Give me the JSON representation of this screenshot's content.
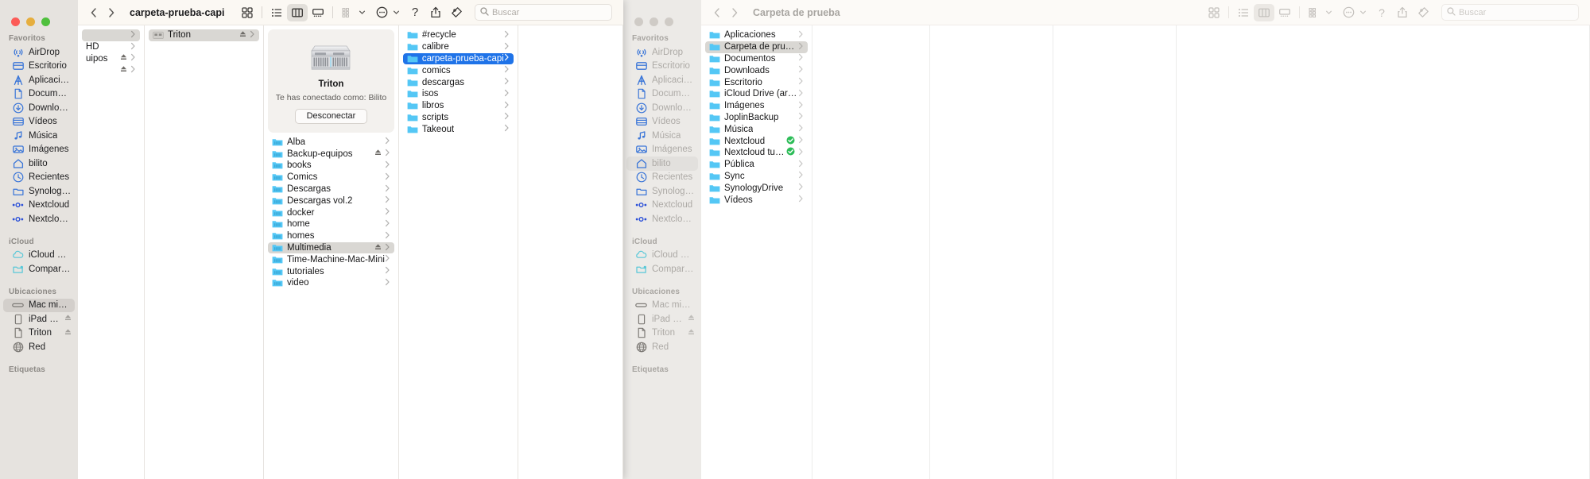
{
  "front_window": {
    "title": "carpeta-prueba-capi",
    "nav": {
      "back_label": "‹",
      "forward_label": "›"
    },
    "search": {
      "placeholder": "Buscar"
    },
    "toolbar": {
      "icon_view": "grid-view-icon",
      "list_view": "list-view-icon",
      "column_view": "column-view-icon",
      "gallery_view": "gallery-view-icon",
      "group_by": "group-by-icon",
      "action_menu": "more-actions-icon",
      "help": "?",
      "share": "share-icon",
      "tags": "tag-icon",
      "search_icon": "search-icon",
      "active_view": "column_view"
    },
    "sidebar": {
      "groups": [
        {
          "title": "Favoritos",
          "items": [
            {
              "label": "AirDrop",
              "icon": "airdrop-icon",
              "selected": false
            },
            {
              "label": "Escritorio",
              "icon": "desktop-icon",
              "selected": false
            },
            {
              "label": "Aplicaciones",
              "icon": "applications-icon",
              "selected": false
            },
            {
              "label": "Documentos",
              "icon": "document-icon",
              "selected": false
            },
            {
              "label": "Downloads",
              "icon": "downloads-icon",
              "selected": false
            },
            {
              "label": "Vídeos",
              "icon": "movies-icon",
              "selected": false
            },
            {
              "label": "Música",
              "icon": "music-icon",
              "selected": false
            },
            {
              "label": "Imágenes",
              "icon": "pictures-icon",
              "selected": false
            },
            {
              "label": "bilito",
              "icon": "home-icon",
              "selected": false
            },
            {
              "label": "Recientes",
              "icon": "recents-clock-icon",
              "selected": false
            },
            {
              "label": "SynologyDrive",
              "icon": "folder-icon",
              "selected": false
            },
            {
              "label": "Nextcloud",
              "icon": "nextcloud-icon",
              "selected": false
            },
            {
              "label": "Nextcloud tuto...",
              "icon": "nextcloud-icon",
              "selected": false
            }
          ]
        },
        {
          "title": "iCloud",
          "items": [
            {
              "label": "iCloud Drive",
              "icon": "icloud-icon",
              "selected": false
            },
            {
              "label": "Compartido",
              "icon": "shared-folder-icon",
              "selected": false
            }
          ]
        },
        {
          "title": "Ubicaciones",
          "items": [
            {
              "label": "Mac mini de Bi...",
              "icon": "mac-mini-icon",
              "selected": true,
              "eject": false
            },
            {
              "label": "iPad Pro de...",
              "icon": "ipad-icon",
              "selected": false,
              "eject": true
            },
            {
              "label": "Triton",
              "icon": "file-server-icon",
              "selected": false,
              "eject": true
            },
            {
              "label": "Red",
              "icon": "network-globe-icon",
              "selected": false,
              "eject": false
            }
          ]
        },
        {
          "title": "Etiquetas",
          "items": []
        }
      ]
    },
    "column_1": {
      "rows": [
        {
          "label": "",
          "icon": "none",
          "selected_gray": true,
          "disclosure": true,
          "eject": false
        },
        {
          "label": "HD",
          "icon": "none",
          "selected_gray": false,
          "disclosure": true,
          "eject": false
        },
        {
          "label": "uipos",
          "icon": "none",
          "selected_gray": false,
          "disclosure": true,
          "eject": true
        },
        {
          "label": "",
          "icon": "none",
          "selected_gray": false,
          "disclosure": true,
          "eject": true
        }
      ]
    },
    "column_2": {
      "rows": [
        {
          "label": "Triton",
          "icon": "file-server-icon",
          "selected_gray": true,
          "disclosure": true,
          "eject": true
        }
      ]
    },
    "preview": {
      "server_name": "Triton",
      "connected_as": "Te has conectado como: Bilito",
      "disconnect_label": "Desconectar",
      "icon": "rack-server-icon",
      "shares": [
        {
          "label": "Alba",
          "eject": false
        },
        {
          "label": "Backup-equipos",
          "eject": true
        },
        {
          "label": "books",
          "eject": false
        },
        {
          "label": "Comics",
          "eject": false
        },
        {
          "label": "Descargas",
          "eject": false
        },
        {
          "label": "Descargas vol.2",
          "eject": false
        },
        {
          "label": "docker",
          "eject": false
        },
        {
          "label": "home",
          "eject": false
        },
        {
          "label": "homes",
          "eject": false
        },
        {
          "label": "Multimedia",
          "eject": true,
          "selected_gray": true
        },
        {
          "label": "Time-Machine-Mac-Mini",
          "eject": false
        },
        {
          "label": "tutoriales",
          "eject": false
        },
        {
          "label": "video",
          "eject": false
        }
      ]
    },
    "column_4": {
      "rows": [
        {
          "label": "#recycle",
          "selected_blue": false
        },
        {
          "label": "calibre",
          "selected_blue": false
        },
        {
          "label": "carpeta-prueba-capi",
          "selected_blue": true
        },
        {
          "label": "comics",
          "selected_blue": false
        },
        {
          "label": "descargas",
          "selected_blue": false
        },
        {
          "label": "isos",
          "selected_blue": false
        },
        {
          "label": "libros",
          "selected_blue": false
        },
        {
          "label": "scripts",
          "selected_blue": false
        },
        {
          "label": "Takeout",
          "selected_blue": false
        }
      ]
    }
  },
  "back_window": {
    "title": "Carpeta de prueba",
    "nav": {
      "back_label": "‹",
      "forward_label": "›"
    },
    "search": {
      "placeholder": "Buscar"
    },
    "toolbar": {
      "icon_view": "grid-view-icon",
      "list_view": "list-view-icon",
      "column_view": "column-view-icon",
      "gallery_view": "gallery-view-icon",
      "group_by": "group-by-icon",
      "action_menu": "more-actions-icon",
      "help": "?",
      "share": "share-icon",
      "tags": "tag-icon",
      "search_icon": "search-icon",
      "active_view": "column_view"
    },
    "sidebar": {
      "groups": [
        {
          "title": "Favoritos",
          "items": [
            {
              "label": "AirDrop",
              "icon": "airdrop-icon",
              "selected": false
            },
            {
              "label": "Escritorio",
              "icon": "desktop-icon",
              "selected": false
            },
            {
              "label": "Aplicaciones",
              "icon": "applications-icon",
              "selected": false
            },
            {
              "label": "Documentos",
              "icon": "document-icon",
              "selected": false
            },
            {
              "label": "Downloads",
              "icon": "downloads-icon",
              "selected": false
            },
            {
              "label": "Vídeos",
              "icon": "movies-icon",
              "selected": false
            },
            {
              "label": "Música",
              "icon": "music-icon",
              "selected": false
            },
            {
              "label": "Imágenes",
              "icon": "pictures-icon",
              "selected": false
            },
            {
              "label": "bilito",
              "icon": "home-icon",
              "selected": true
            },
            {
              "label": "Recientes",
              "icon": "recents-clock-icon",
              "selected": false
            },
            {
              "label": "SynologyDrive",
              "icon": "folder-icon",
              "selected": false
            },
            {
              "label": "Nextcloud",
              "icon": "nextcloud-icon",
              "selected": false
            },
            {
              "label": "Nextcloud tuto...",
              "icon": "nextcloud-icon",
              "selected": false
            }
          ]
        },
        {
          "title": "iCloud",
          "items": [
            {
              "label": "iCloud Drive",
              "icon": "icloud-icon",
              "selected": false
            },
            {
              "label": "Compartido",
              "icon": "shared-folder-icon",
              "selected": false
            }
          ]
        },
        {
          "title": "Ubicaciones",
          "items": [
            {
              "label": "Mac mini de Bi...",
              "icon": "mac-mini-icon",
              "selected": false,
              "eject": false
            },
            {
              "label": "iPad Pro de...",
              "icon": "ipad-icon",
              "selected": false,
              "eject": true
            },
            {
              "label": "Triton",
              "icon": "file-server-icon",
              "selected": false,
              "eject": true
            },
            {
              "label": "Red",
              "icon": "network-globe-icon",
              "selected": false,
              "eject": false
            }
          ]
        },
        {
          "title": "Etiquetas",
          "items": []
        }
      ]
    },
    "column_1": {
      "rows": [
        {
          "label": "Aplicaciones",
          "selected_gray": false,
          "synced": false
        },
        {
          "label": "Carpeta de prueba",
          "selected_gray": true,
          "synced": false
        },
        {
          "label": "Documentos",
          "selected_gray": false,
          "synced": false
        },
        {
          "label": "Downloads",
          "selected_gray": false,
          "synced": false
        },
        {
          "label": "Escritorio",
          "selected_gray": false,
          "synced": false
        },
        {
          "label": "iCloud Drive (archivado)",
          "selected_gray": false,
          "synced": false
        },
        {
          "label": "Imágenes",
          "selected_gray": false,
          "synced": false
        },
        {
          "label": "JoplinBackup",
          "selected_gray": false,
          "synced": false
        },
        {
          "label": "Música",
          "selected_gray": false,
          "synced": false
        },
        {
          "label": "Nextcloud",
          "selected_gray": false,
          "synced": true
        },
        {
          "label": "Nextcloud tutoriales",
          "selected_gray": false,
          "synced": true
        },
        {
          "label": "Pública",
          "selected_gray": false,
          "synced": false
        },
        {
          "label": "Sync",
          "selected_gray": false,
          "synced": false
        },
        {
          "label": "SynologyDrive",
          "selected_gray": false,
          "synced": false
        },
        {
          "label": "Vídeos",
          "selected_gray": false,
          "synced": false
        }
      ]
    }
  },
  "colors": {
    "selection_blue": "#1f73e8",
    "folder_blue": "#54c7f5",
    "sidebar_bg": "#e6e3df",
    "toolbar_bg": "#fbf8f3",
    "sync_green": "#2ebd59"
  }
}
